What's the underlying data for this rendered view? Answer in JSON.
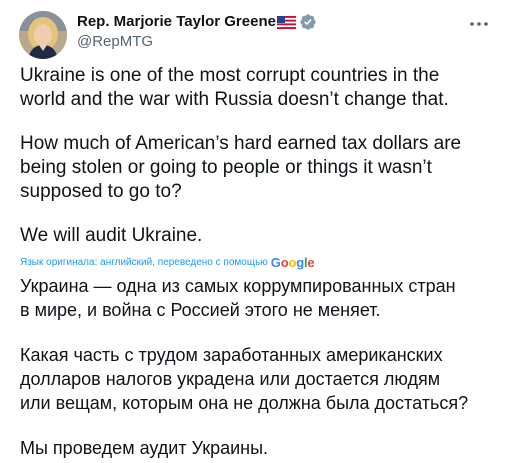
{
  "author": {
    "name": "Rep. Marjorie Taylor Greene",
    "handle": "@RepMTG",
    "flag": "us-flag-emoji",
    "verified": "verified-badge-icon"
  },
  "tweet": {
    "paragraphs": [
      "Ukraine is one of the most corrupt countries in the\nworld and the war with Russia doesn’t change that.",
      "How much of American’s hard earned tax dollars are\nbeing stolen or going to people or things it wasn’t\nsupposed to go to?",
      "We will audit Ukraine."
    ]
  },
  "translation": {
    "note": "Язык оригинала: английский, переведено с помощью",
    "provider": "Google",
    "paragraphs": [
      "Украина — одна из самых коррумпированных стран\nв мире, и война с Россией этого не меняет.",
      "Какая часть с трудом заработанных американских\nдолларов налогов украдена или достается людям\nили вещам, которым она не должна была достаться?",
      "Мы проведем аудит Украины."
    ]
  },
  "icons": {
    "more": "more-options-icon"
  },
  "colors": {
    "link": "#1d9bf0",
    "text": "#0f1419",
    "secondary": "#536471"
  }
}
